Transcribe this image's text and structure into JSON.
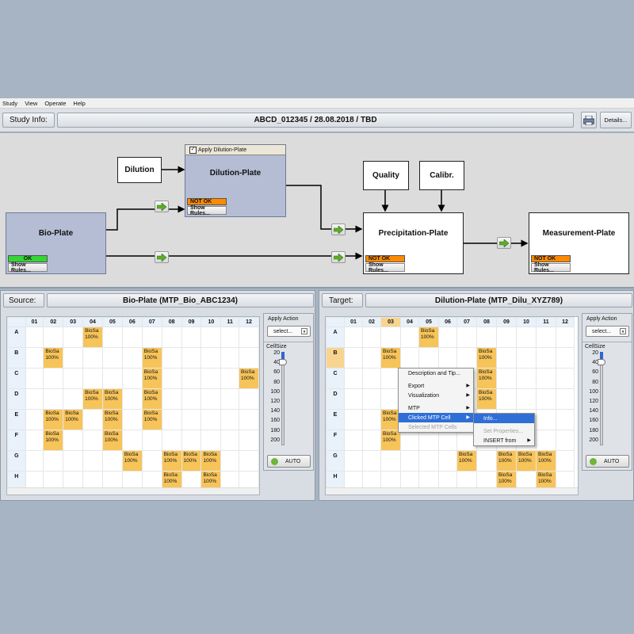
{
  "menubar": [
    "Study",
    "View",
    "Operate",
    "Help"
  ],
  "study": {
    "label": "Study Info:",
    "value": "ABCD_012345 / 28.08.2018 / TBD",
    "details": "Details..."
  },
  "workflow": {
    "dilution": "Dilution",
    "apply_dilution": "Apply Dilution-Plate",
    "dilution_plate": "Dilution-Plate",
    "bio_plate": "Bio-Plate",
    "quality": "Quality",
    "calibr": "Calibr.",
    "precip": "Precipitation-Plate",
    "measure": "Measurement-Plate",
    "ok": "OK",
    "not_ok": "NOT OK",
    "show_rules": "Show Rules..."
  },
  "columns": [
    "01",
    "02",
    "03",
    "04",
    "05",
    "06",
    "07",
    "08",
    "09",
    "10",
    "11",
    "12"
  ],
  "rows": [
    "A",
    "B",
    "C",
    "D",
    "E",
    "F",
    "G",
    "H"
  ],
  "cell_text": "BioSa\n100%",
  "source": {
    "label": "Source:",
    "title": "Bio-Plate (MTP_Bio_ABC1234)",
    "filled": [
      [
        0,
        3
      ],
      [
        1,
        1
      ],
      [
        1,
        6
      ],
      [
        2,
        6
      ],
      [
        2,
        11
      ],
      [
        3,
        3
      ],
      [
        3,
        4
      ],
      [
        3,
        6
      ],
      [
        4,
        1
      ],
      [
        4,
        2
      ],
      [
        4,
        4
      ],
      [
        4,
        6
      ],
      [
        5,
        1
      ],
      [
        5,
        4
      ],
      [
        6,
        5
      ],
      [
        6,
        7
      ],
      [
        6,
        8
      ],
      [
        6,
        9
      ],
      [
        7,
        7
      ],
      [
        7,
        9
      ]
    ]
  },
  "target": {
    "label": "Target:",
    "title": "Dilution-Plate (MTP_Dilu_XYZ789)",
    "filled": [
      [
        0,
        4
      ],
      [
        1,
        2
      ],
      [
        1,
        7
      ],
      [
        2,
        7
      ],
      [
        3,
        7
      ],
      [
        4,
        2
      ],
      [
        5,
        2
      ],
      [
        6,
        6
      ],
      [
        6,
        8
      ],
      [
        6,
        9
      ],
      [
        6,
        10
      ],
      [
        7,
        8
      ],
      [
        7,
        10
      ]
    ],
    "selected_col": 2,
    "selected_row": 1
  },
  "actions": {
    "apply_action": "Apply Action",
    "select": "select...",
    "cellsize": "CellSize",
    "auto": "AUTO",
    "ticks": [
      "20",
      "40",
      "60",
      "80",
      "100",
      "120",
      "140",
      "160",
      "180",
      "200"
    ],
    "cellsize_value": 40
  },
  "context_menu": {
    "items": [
      {
        "label": "Description and Tip...",
        "sub": false,
        "disabled": false
      },
      {
        "label": "Export",
        "sub": true,
        "disabled": false
      },
      {
        "label": "Visualization",
        "sub": true,
        "disabled": false
      },
      {
        "label": "MTP",
        "sub": true,
        "disabled": false
      },
      {
        "label": "Clicked MTP Cell",
        "sub": true,
        "disabled": false
      },
      {
        "label": "Selected MTP Cells",
        "sub": false,
        "disabled": true
      }
    ],
    "submenu": [
      {
        "label": "Info...",
        "sub": false,
        "disabled": false
      },
      {
        "label": "Set Properties...",
        "sub": false,
        "disabled": true
      },
      {
        "label": "INSERT from",
        "sub": true,
        "disabled": false
      }
    ]
  },
  "colors": {
    "filled_cell": "#f7c45a",
    "ok": "#33d633",
    "not_ok": "#ff8a00",
    "highlight": "#2e6ed6"
  }
}
